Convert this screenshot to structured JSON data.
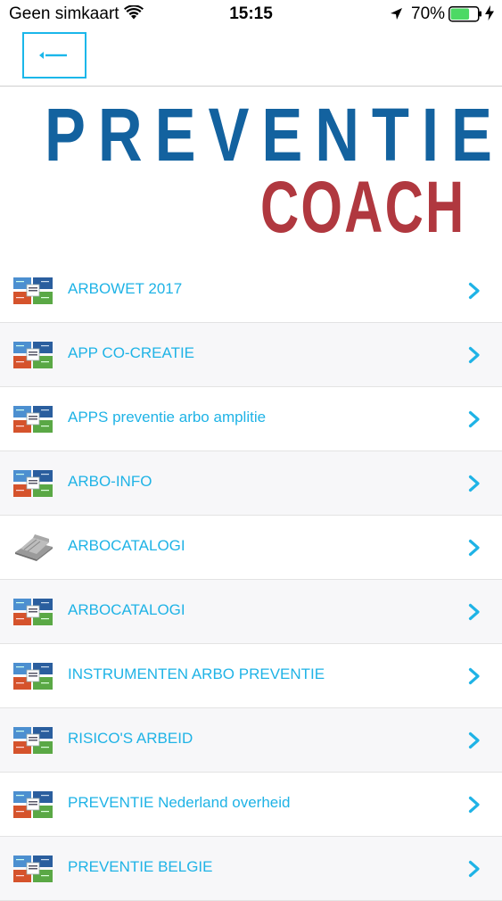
{
  "status_bar": {
    "carrier": "Geen simkaart",
    "time": "15:15",
    "battery_percent": "70%",
    "battery_level": 0.7,
    "icons": [
      "wifi-icon",
      "location-arrow-icon",
      "battery-icon",
      "charging-bolt-icon"
    ]
  },
  "nav": {
    "back_icon": "back-arrow-icon"
  },
  "header": {
    "logo_line1": "PREVENTIE",
    "logo_line2": "COACH",
    "colors": {
      "line1": "#13629f",
      "line2": "#b0383f"
    }
  },
  "list": {
    "accent_color": "#1fb3e6",
    "items": [
      {
        "label": "ARBOWET 2017",
        "icon": "tiles-thumbnail-icon"
      },
      {
        "label": "APP CO-CREATIE",
        "icon": "tiles-thumbnail-icon"
      },
      {
        "label": "APPS preventie arbo amplitie",
        "icon": "tiles-thumbnail-icon"
      },
      {
        "label": "ARBO-INFO",
        "icon": "tiles-thumbnail-icon"
      },
      {
        "label": "ARBOCATALOGI",
        "icon": "books-thumbnail-icon"
      },
      {
        "label": "ARBOCATALOGI",
        "icon": "tiles-thumbnail-icon"
      },
      {
        "label": "INSTRUMENTEN ARBO PREVENTIE",
        "icon": "tiles-thumbnail-icon"
      },
      {
        "label": "RISICO'S ARBEID",
        "icon": "tiles-thumbnail-icon"
      },
      {
        "label": "PREVENTIE Nederland overheid",
        "icon": "tiles-thumbnail-icon"
      },
      {
        "label": "PREVENTIE BELGIE",
        "icon": "tiles-thumbnail-icon"
      }
    ]
  }
}
